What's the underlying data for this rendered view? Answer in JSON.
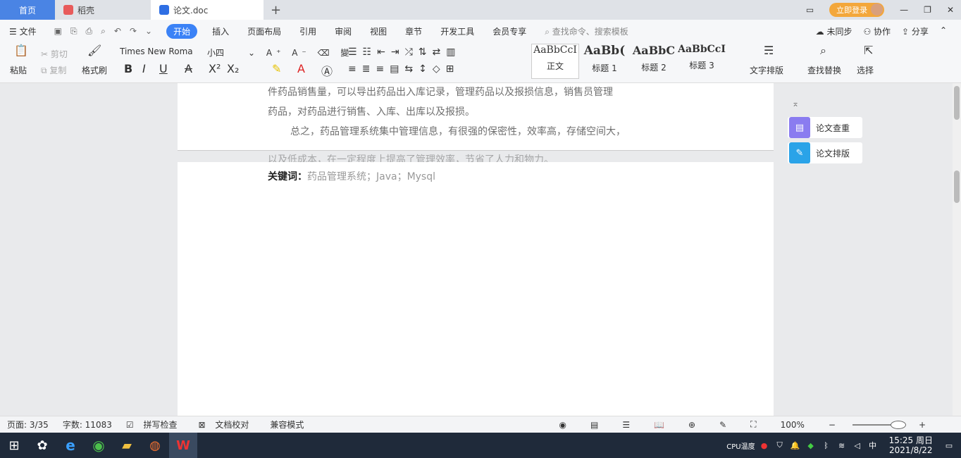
{
  "tabs": {
    "home": "首页",
    "recent": "稻壳",
    "doc": "论文.doc"
  },
  "titlebar": {
    "login": "立即登录"
  },
  "menu": {
    "file": "文件",
    "items": [
      "开始",
      "插入",
      "页面布局",
      "引用",
      "审阅",
      "视图",
      "章节",
      "开发工具",
      "会员专享"
    ],
    "search": "查找命令、搜索模板",
    "sync": "未同步",
    "collab": "协作",
    "share": "分享"
  },
  "ribbon": {
    "paste": "粘贴",
    "cut": "剪切",
    "copy": "复制",
    "format_painter": "格式刷",
    "font_name": "Times New Roma",
    "font_size": "小四",
    "styles": [
      {
        "sample": "AaBbCcI",
        "name": "正文"
      },
      {
        "sample": "AaBb(",
        "name": "标题 1"
      },
      {
        "sample": "AaBbC",
        "name": "标题 2"
      },
      {
        "sample": "AaBbCcI",
        "name": "标题 3"
      }
    ],
    "text_layout": "文字排版",
    "find_replace": "查找替换",
    "select": "选择"
  },
  "document": {
    "line1": "件药品销售量，可以导出药品出入库记录，管理药品以及报损信息，销售员管理",
    "line2": "药品，对药品进行销售、入库、出库以及报损。",
    "line3": "总之，药品管理系统集中管理信息，有很强的保密性，效率高，存储空间大，",
    "line4": "以及低成本，在一定程度上提高了管理效率，节省了人力和物力。",
    "keywords_label": "关键词：",
    "keywords": "药品管理系统；Java；Mysql"
  },
  "side_panel": {
    "item1": "论文查重",
    "item2": "论文排版"
  },
  "status": {
    "page": "页面: 3/35",
    "words": "字数: 11083",
    "spell": "拼写检查",
    "proof": "文档校对",
    "compat": "兼容模式",
    "zoom": "100%"
  },
  "taskbar": {
    "cpu": "CPU温度",
    "time": "15:25 周日",
    "date": "2021/8/22",
    "ime": "中"
  },
  "colors": {
    "accent": "#3b82f6",
    "home_tab": "#4a84e4",
    "login": "#f3a73b",
    "taskbar": "#1f2a3a"
  }
}
